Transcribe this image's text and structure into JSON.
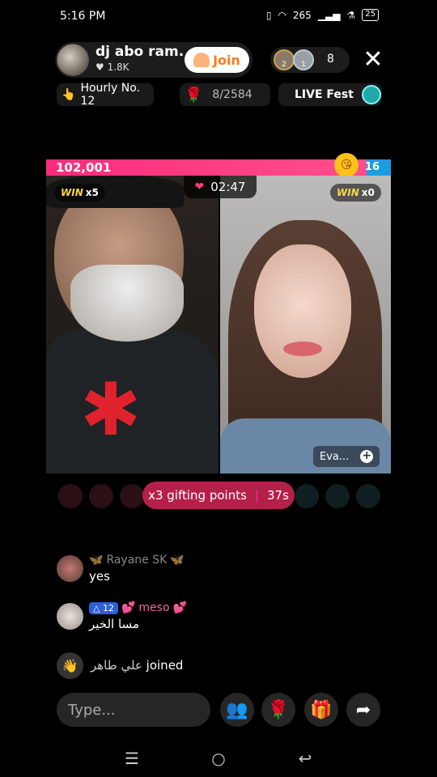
{
  "status": {
    "time": "5:16 PM",
    "battery": "25",
    "network": "265"
  },
  "host": {
    "name": "dj abo ram...",
    "likes": "♥ 1.8K",
    "join_label": "Join"
  },
  "viewers": {
    "count": "8",
    "badges": [
      "2",
      "1"
    ]
  },
  "chips": {
    "hourly": "Hourly No. 12",
    "roses_value": "8/2584",
    "live_fest": "LIVE Fest"
  },
  "battle": {
    "left_score": "102,001",
    "right_score": "16",
    "timer": "02:47",
    "left_win_label": "WIN",
    "left_win_count": "x5",
    "right_win_label": "WIN",
    "right_win_count": "x0",
    "guest_name": "Eva..."
  },
  "gifting": {
    "label": "x3 gifting points",
    "timer": "37s"
  },
  "comments": [
    {
      "name": "Rayane SK",
      "text": "yes"
    },
    {
      "name": "meso",
      "level": "12",
      "text": "مسا الخير"
    }
  ],
  "join_event": {
    "name": "علي طاهر",
    "action": "joined"
  },
  "input": {
    "placeholder": "Type..."
  },
  "icons": {
    "people": "people-icon",
    "rose": "rose-icon",
    "gift": "gift-icon",
    "share": "share-icon"
  }
}
